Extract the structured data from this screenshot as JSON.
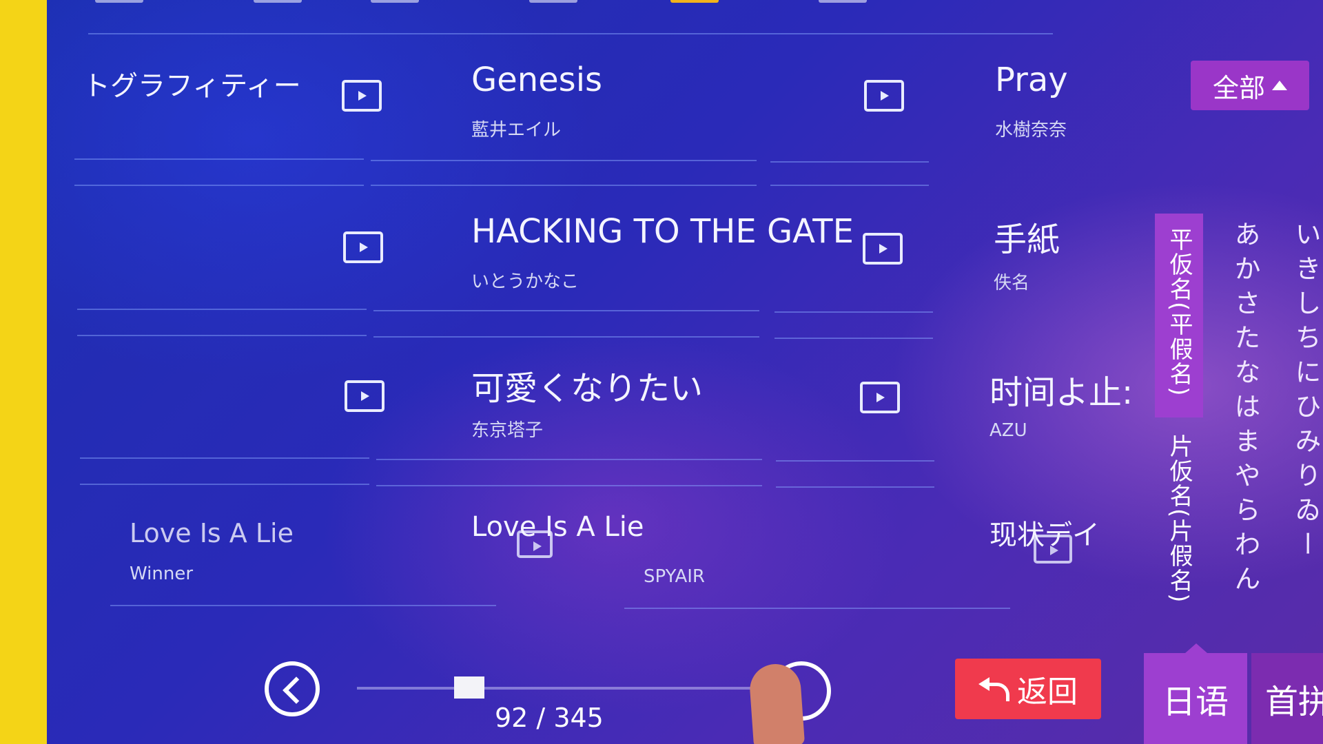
{
  "rows": [
    {
      "col1": {
        "title": "トグラフィティー",
        "artist": ""
      },
      "col2": {
        "title": "Genesis",
        "artist": "藍井エイル"
      },
      "col3": {
        "title": "Pray",
        "artist": "水樹奈奈"
      }
    },
    {
      "col1": {
        "title": "",
        "artist": ""
      },
      "col2": {
        "title": "HACKING TO THE GATE",
        "artist": "いとうかなこ"
      },
      "col3": {
        "title": "手紙",
        "artist": "佚名"
      }
    },
    {
      "col1": {
        "title": "",
        "artist": ""
      },
      "col2": {
        "title": "可愛くなりたい",
        "artist": "东京塔子"
      },
      "col3": {
        "title": "时间よ止:",
        "artist": "AZU"
      }
    },
    {
      "col1": {
        "title": "Love Is A Lie",
        "artist": "Winner"
      },
      "col2": {
        "title": "Love Is A Lie",
        "artist": "SPYAIR"
      },
      "col3": {
        "title": "现状デイ",
        "artist": ""
      }
    }
  ],
  "filter": {
    "label": "全部"
  },
  "kana_tabs": {
    "hiragana": "平仮名(平假名)",
    "katakana": "片仮名(片假名)"
  },
  "kana_rows": [
    {
      "row": "あかさたなはまやらわん"
    },
    {
      "row": "いきしちにひみりゐー"
    }
  ],
  "pager": {
    "current": 92,
    "total": 345,
    "text": "92 / 345",
    "progress_fraction": 0.267
  },
  "buttons": {
    "return_label": "返回",
    "language_label": "日语",
    "first_label": "首拼"
  },
  "icons": {
    "play": "play-video-icon",
    "back": "chevron-left-icon",
    "return": "return-arrow-icon",
    "caret": "caret-up-icon"
  },
  "colors": {
    "accent_purple": "#9d3fd0",
    "return_red": "#f03a4d",
    "background_blue": "#1c2fb0",
    "yellow_bezel": "#f4d417"
  }
}
